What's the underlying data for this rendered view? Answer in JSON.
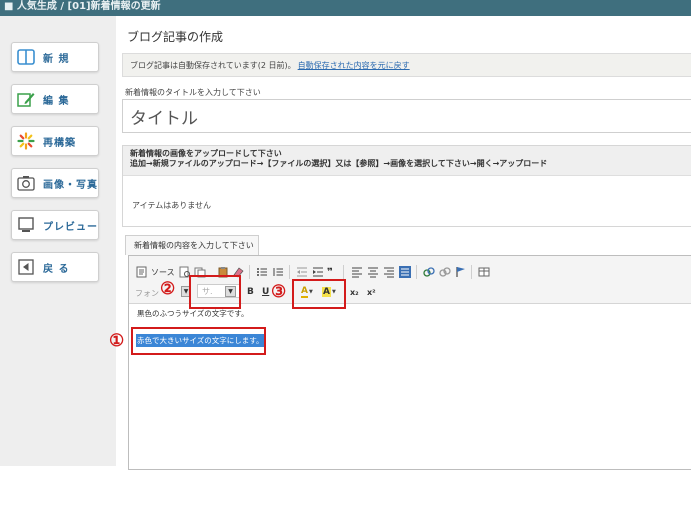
{
  "breadcrumb": "■ 人気生成 / [01]新着情報の更新",
  "sidebar": {
    "items": [
      {
        "label": "新 規",
        "icon": "new-panel-icon"
      },
      {
        "label": "編 集",
        "icon": "edit-pencil-icon"
      },
      {
        "label": "再構築",
        "icon": "rebuild-sparkle-icon"
      },
      {
        "label": "画像・写真",
        "icon": "camera-icon"
      },
      {
        "label": "プレビュー",
        "icon": "preview-monitor-icon"
      },
      {
        "label": "戻 る",
        "icon": "back-arrow-icon"
      }
    ]
  },
  "page_title": "ブログ記事の作成",
  "autosave": {
    "text": "ブログ記事は自動保存されています(2 日前)。",
    "restore_link": "自動保存された内容を元に戻す"
  },
  "title_field": {
    "label": "新着情報のタイトルを入力して下さい",
    "value": "タイトル"
  },
  "upload": {
    "heading_line1": "新着情報の画像をアップロードして下さい",
    "heading_line2": "追加→新規ファイルのアップロード→【ファイルの選択】又は【参照】→画像を選択して下さい→開く→アップロード",
    "empty_text": "アイテムはありません"
  },
  "content_tab": "新着情報の内容を入力して下さい",
  "toolbar": {
    "source_label": "ソース",
    "font_label": "フォン",
    "size_label": "サ.",
    "bold": "B",
    "underline": "U",
    "text_color": "A",
    "bg_color": "A",
    "subscript": "x₂",
    "superscript": "x²"
  },
  "content": {
    "line1": "黒色のふつうサイズの文字です。",
    "line2": "赤色で大きいサイズの文字にします。"
  },
  "annotations": {
    "one": "①",
    "two": "②",
    "three": "③"
  },
  "colors": {
    "topbar": "#3f6f7e",
    "highlight": "#d31b1b",
    "selection": "#3b86d6",
    "nav_text": "#2d6a99"
  }
}
